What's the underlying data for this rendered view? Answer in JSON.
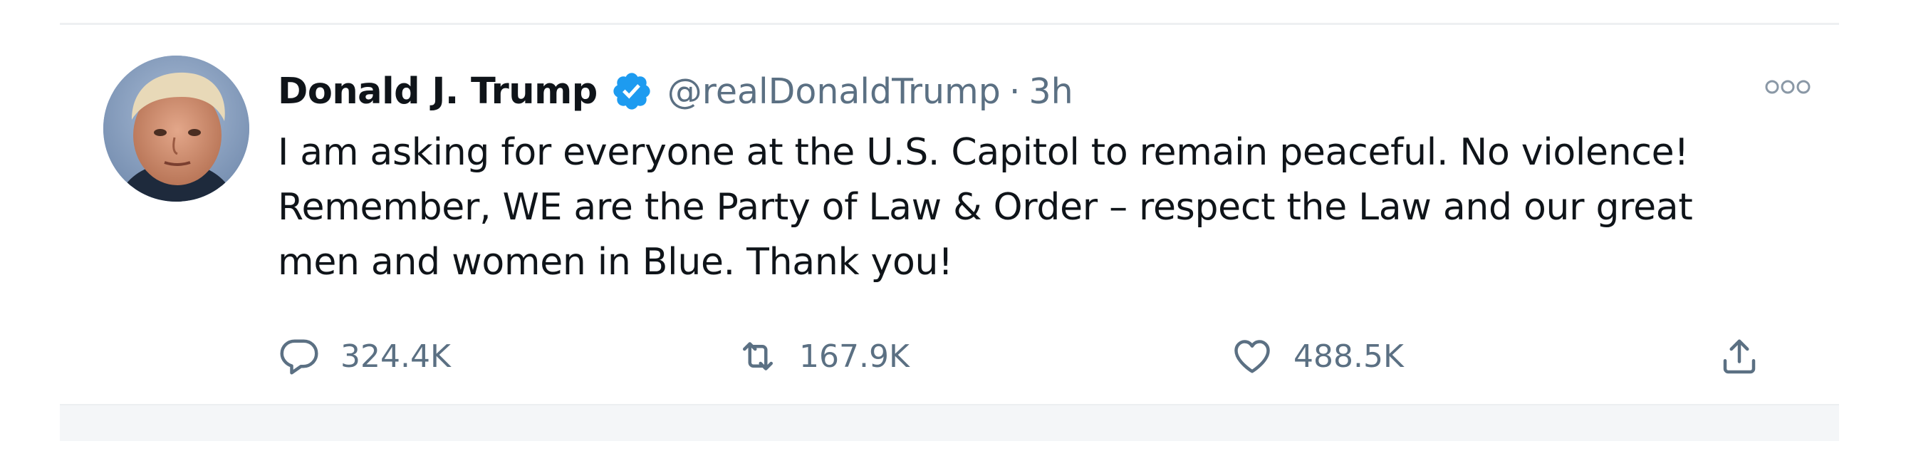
{
  "tweet": {
    "author": {
      "name": "Donald J. Trump",
      "handle": "@realDonaldTrump",
      "verified": true,
      "avatar": "portrait-avatar"
    },
    "separator": "·",
    "time": "3h",
    "text_lines": [
      "I am asking for everyone at the U.S. Capitol to remain peaceful. No violence!",
      "Remember, WE are the Party of Law & Order – respect the Law and our great",
      "men and women in Blue. Thank you!"
    ],
    "actions": {
      "reply": {
        "icon": "reply-bubble-icon",
        "count": "324.4K"
      },
      "retweet": {
        "icon": "retweet-icon",
        "count": "167.9K"
      },
      "like": {
        "icon": "heart-icon",
        "count": "488.5K"
      },
      "share": {
        "icon": "share-icon"
      }
    },
    "more_icon": "more-options-icon"
  },
  "colors": {
    "name_text": "#0f1419",
    "secondary_text": "#5b7083",
    "verified_blue": "#1d9bf0",
    "divider": "#eef0f2"
  }
}
